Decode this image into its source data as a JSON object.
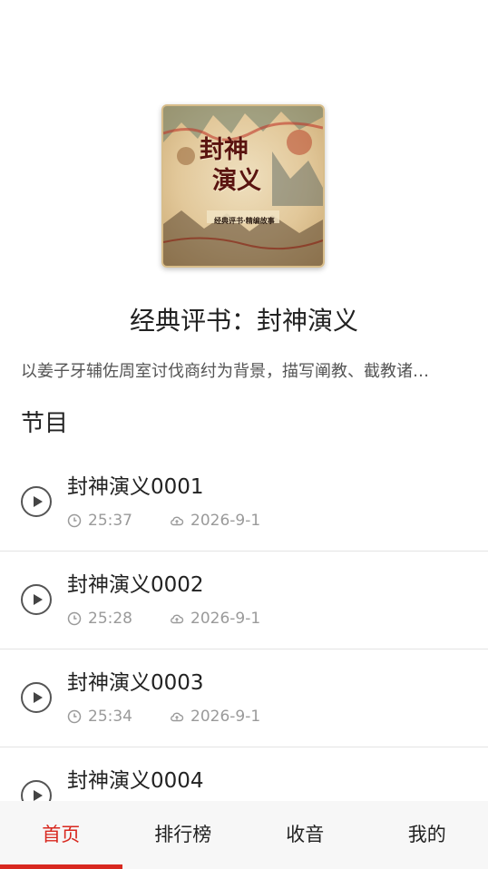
{
  "book": {
    "cover": {
      "title_line1": "封神",
      "title_line2": "演义",
      "subtitle": "经典评书·精编故事"
    },
    "title": "经典评书：封神演义",
    "description": "以姜子牙辅佐周室讨伐商纣为背景，描写阐教、截教诸…"
  },
  "section": {
    "title": "节目"
  },
  "episodes": [
    {
      "title": "封神演义0001",
      "duration": "25:37",
      "date": "2026-9-1"
    },
    {
      "title": "封神演义0002",
      "duration": "25:28",
      "date": "2026-9-1"
    },
    {
      "title": "封神演义0003",
      "duration": "25:34",
      "date": "2026-9-1"
    },
    {
      "title": "封神演义0004",
      "duration": "",
      "date": ""
    }
  ],
  "nav": {
    "items": [
      {
        "label": "首页",
        "active": true
      },
      {
        "label": "排行榜",
        "active": false
      },
      {
        "label": "收音",
        "active": false
      },
      {
        "label": "我的",
        "active": false
      }
    ],
    "accent": "#d8281f"
  }
}
